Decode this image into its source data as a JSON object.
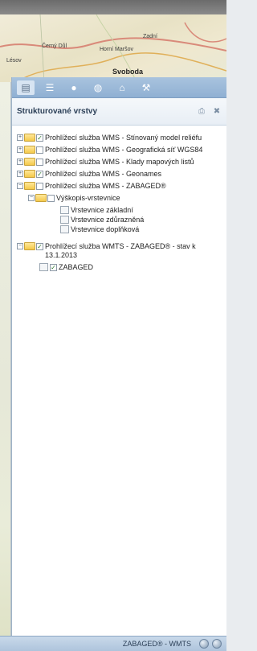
{
  "map": {
    "labels": [
      "Lésov",
      "Černý Důl",
      "Svoboda",
      "Zadní",
      "Horní Maršov"
    ]
  },
  "panel": {
    "tabs": [
      {
        "icon": "layers-icon"
      },
      {
        "icon": "list-icon"
      },
      {
        "icon": "info-icon"
      },
      {
        "icon": "globe-icon"
      },
      {
        "icon": "print-icon"
      },
      {
        "icon": "tools-icon"
      }
    ],
    "title": "Strukturované vrstvy",
    "header_icons": [
      "print-icon",
      "close-icon"
    ]
  },
  "tree": [
    {
      "label": "Prohlížecí služba WMS - Stínovaný model reliéfu",
      "checked": true
    },
    {
      "label": "Prohlížecí služba WMS - Geografická síť WGS84",
      "checked": false
    },
    {
      "label": "Prohlížecí služba WMS - Klady mapových listů",
      "checked": false
    },
    {
      "label": "Prohlížecí služba WMS - Geonames",
      "checked": true
    },
    {
      "label": "Prohlížecí služba WMS - ZABAGED®",
      "checked": false
    },
    {
      "label": "Výškopis-vrstevnice",
      "checked": false
    },
    {
      "label": "Vrstevnice základní"
    },
    {
      "label": "Vrstevnice zdůrazněná"
    },
    {
      "label": "Vrstevnice doplňková"
    },
    {
      "label": "Prohlížecí služba WMTS - ZABAGED® - stav k 13.1.2013",
      "checked": true
    },
    {
      "label": "ZABAGED",
      "checked": true
    }
  ],
  "status": {
    "text": "ZABAGED® - WMTS"
  }
}
